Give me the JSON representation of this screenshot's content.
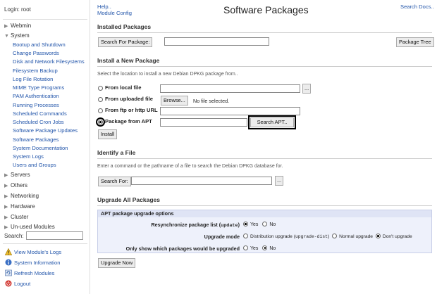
{
  "sidebar": {
    "login": "Login: root",
    "categories": [
      {
        "label": "Webmin"
      },
      {
        "label": "System"
      },
      {
        "label": "Servers"
      },
      {
        "label": "Others"
      },
      {
        "label": "Networking"
      },
      {
        "label": "Hardware"
      },
      {
        "label": "Cluster"
      },
      {
        "label": "Un-used Modules"
      }
    ],
    "system_items": [
      "Bootup and Shutdown",
      "Change Passwords",
      "Disk and Network Filesystems",
      "Filesystem Backup",
      "Log File Rotation",
      "MIME Type Programs",
      "PAM Authentication",
      "Running Processes",
      "Scheduled Commands",
      "Scheduled Cron Jobs",
      "Software Package Updates",
      "Software Packages",
      "System Documentation",
      "System Logs",
      "Users and Groups"
    ],
    "search_label": "Search:",
    "bottom_links": [
      {
        "label": "View Module's Logs",
        "icon": "warning-icon"
      },
      {
        "label": "System Information",
        "icon": "info-icon"
      },
      {
        "label": "Refresh Modules",
        "icon": "refresh-icon"
      },
      {
        "label": "Logout",
        "icon": "logout-icon"
      }
    ]
  },
  "header": {
    "help": "Help..",
    "module_config": "Module Config",
    "title": "Software Packages",
    "search_docs": "Search Docs.."
  },
  "installed": {
    "title": "Installed Packages",
    "search_button": "Search For Package:",
    "search_value": "",
    "tree_button": "Package Tree"
  },
  "install": {
    "title": "Install a New Package",
    "desc": "Select the location to install a new Debian DPKG package from..",
    "opt_local": "From local file",
    "opt_uploaded": "From uploaded file",
    "browse": "Browse...",
    "no_file": "No file selected.",
    "opt_url": "From ftp or http URL",
    "opt_apt": "Package from APT",
    "search_apt": "Search APT..",
    "install_button": "Install",
    "ellipsis": "..."
  },
  "identify": {
    "title": "Identify a File",
    "desc": "Enter a command or the pathname of a file to search the Debian DPKG database for.",
    "search_button": "Search For:"
  },
  "upgrade": {
    "title": "Upgrade All Packages",
    "box_title": "APT package upgrade options",
    "resync_label": "Resynchronize package list (",
    "resync_code": "update",
    "resync_label_end": ")",
    "yes": "Yes",
    "no": "No",
    "mode_label": "Upgrade mode",
    "mode_dist": "Distribution upgrade (",
    "mode_dist_code": "upgrade-dist",
    "mode_dist_end": ")",
    "mode_normal": "Normal upgrade",
    "mode_dont": "Don't upgrade",
    "show_label": "Only show which packages would be upgraded",
    "upgrade_button": "Upgrade Now"
  }
}
